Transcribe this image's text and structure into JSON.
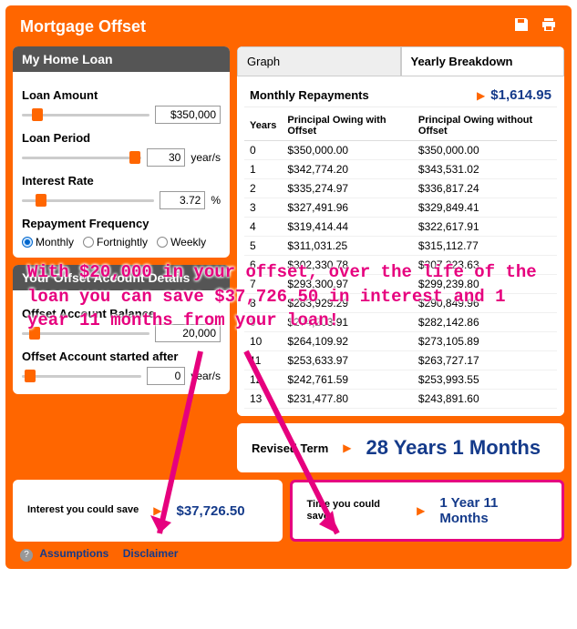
{
  "title": "Mortgage Offset",
  "leftPanel1": {
    "title": "My Home Loan",
    "loanAmountLabel": "Loan Amount",
    "loanAmount": "$350,000",
    "loanPeriodLabel": "Loan Period",
    "loanPeriod": "30",
    "loanPeriodUnit": "year/s",
    "interestRateLabel": "Interest Rate",
    "interestRate": "3.72",
    "interestRateUnit": "%",
    "freqLabel": "Repayment Frequency",
    "freq": {
      "monthly": "Monthly",
      "fortnightly": "Fortnightly",
      "weekly": "Weekly"
    }
  },
  "leftPanel2": {
    "title": "Your Offset Account Details",
    "balanceLabel": "Offset Account Balance",
    "balance": "20,000",
    "startLabel": "Offset Account started after",
    "start": "0",
    "startUnit": "year/s"
  },
  "tabs": {
    "graph": "Graph",
    "yearly": "Yearly Breakdown"
  },
  "monthlyRepLabel": "Monthly Repayments",
  "monthlyRep": "$1,614.95",
  "tableHeaders": {
    "years": "Years",
    "withOffset": "Principal Owing with Offset",
    "withoutOffset": "Principal Owing without Offset"
  },
  "rows": [
    {
      "y": "0",
      "a": "$350,000.00",
      "b": "$350,000.00"
    },
    {
      "y": "1",
      "a": "$342,774.20",
      "b": "$343,531.02"
    },
    {
      "y": "2",
      "a": "$335,274.97",
      "b": "$336,817.24"
    },
    {
      "y": "3",
      "a": "$327,491.96",
      "b": "$329,849.41"
    },
    {
      "y": "4",
      "a": "$319,414.44",
      "b": "$322,617.91"
    },
    {
      "y": "5",
      "a": "$311,031.25",
      "b": "$315,112.77"
    },
    {
      "y": "6",
      "a": "$302,330.78",
      "b": "$307,323.63"
    },
    {
      "y": "7",
      "a": "$293,300.97",
      "b": "$299,239.80"
    },
    {
      "y": "8",
      "a": "$283,929.29",
      "b": "$290,849.96"
    },
    {
      "y": "9",
      "a": "$274,203.91",
      "b": "$282,142.86"
    },
    {
      "y": "10",
      "a": "$264,109.92",
      "b": "$273,105.89"
    },
    {
      "y": "11",
      "a": "$253,633.97",
      "b": "$263,727.17"
    },
    {
      "y": "12",
      "a": "$242,761.59",
      "b": "$253,993.55"
    },
    {
      "y": "13",
      "a": "$231,477.80",
      "b": "$243,891.60"
    }
  ],
  "revisedTermLabel": "Revised Term",
  "revisedTerm": "28 Years 1 Months",
  "interestSaveLabel": "Interest you could save",
  "interestSave": "$37,726.50",
  "timeSaveLabel": "Time you could save",
  "timeSave": "1 Year 11 Months",
  "footer": {
    "assumptions": "Assumptions",
    "disclaimer": "Disclaimer"
  },
  "annotation": "With $20,000 in your offset, over the life of the loan you can save $37,726.50 in interest and 1 year 11 months from your loan!"
}
